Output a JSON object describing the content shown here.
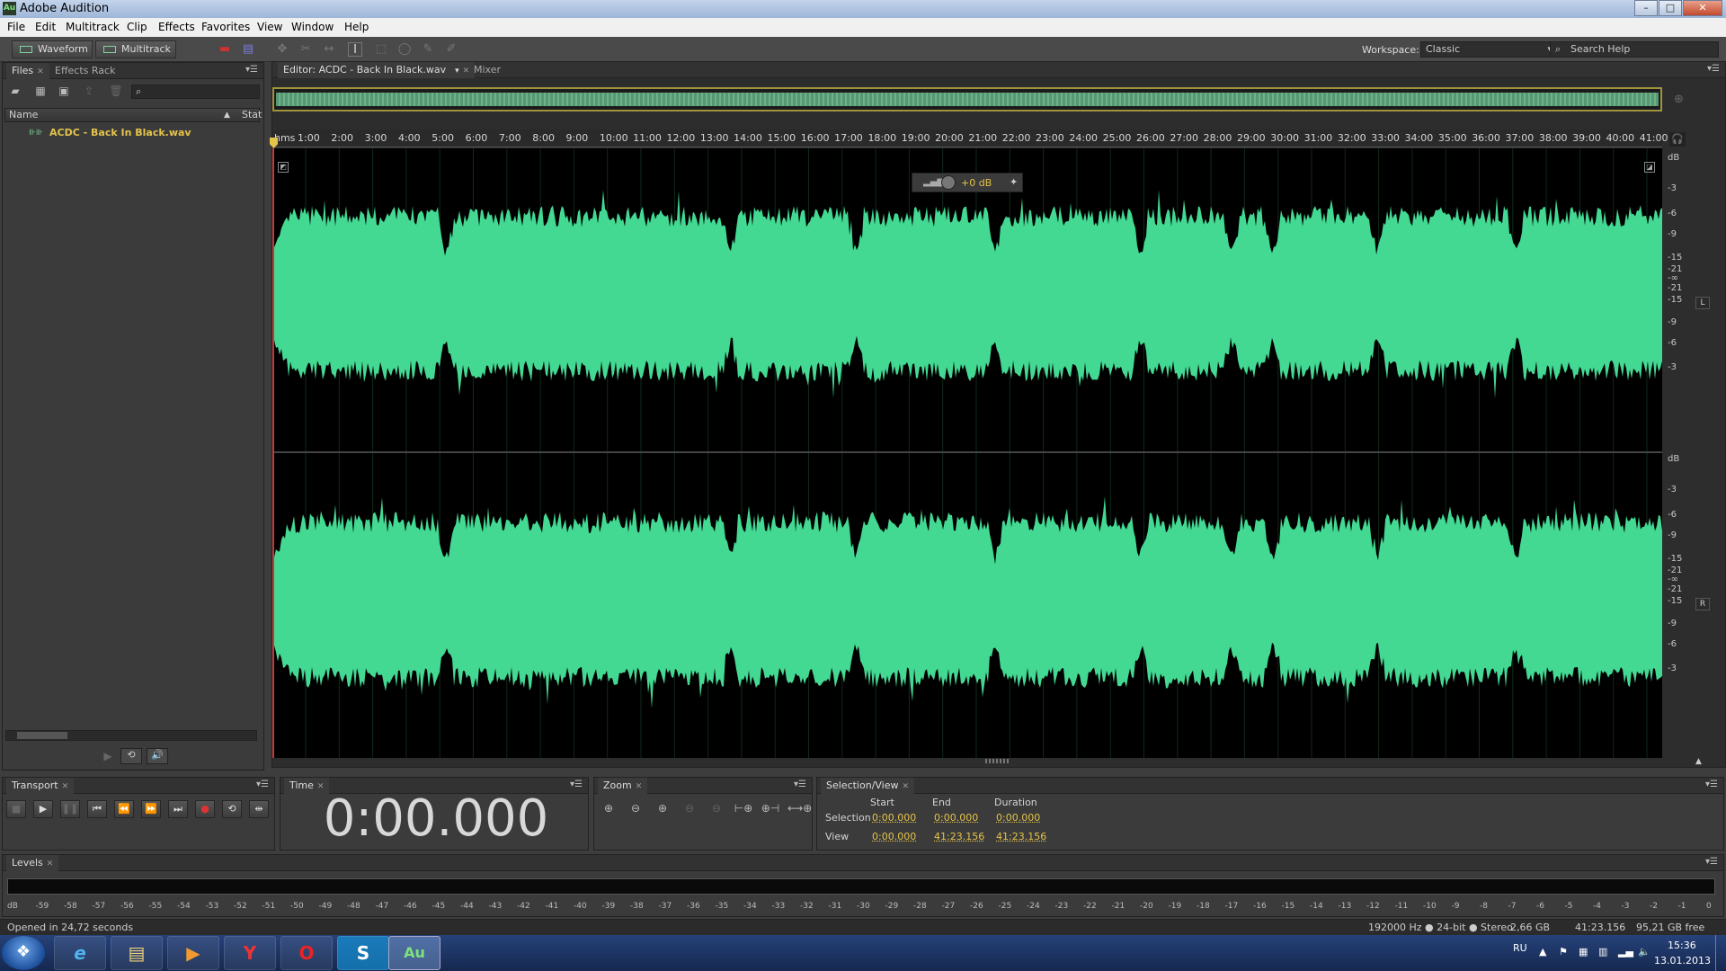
{
  "window": {
    "title": "Adobe Audition",
    "app_icon": "Au",
    "controls": [
      "–",
      "□",
      "✕"
    ]
  },
  "menu": [
    "File",
    "Edit",
    "Multitrack",
    "Clip",
    "Effects",
    "Favorites",
    "View",
    "Window",
    "Help"
  ],
  "toolbar": {
    "waveform_label": "Waveform",
    "multitrack_label": "Multitrack",
    "workspace_label": "Workspace:",
    "workspace_value": "Classic",
    "search_placeholder": "Search Help"
  },
  "files_panel": {
    "tabs": [
      "Files",
      "Effects Rack"
    ],
    "search_value": "",
    "columns": [
      "Name",
      "Stat"
    ],
    "files": [
      {
        "name": "ACDC - Back In Black.wav"
      }
    ]
  },
  "editor": {
    "tabs": [
      "Editor: ACDC - Back In Black.wav",
      "Mixer"
    ],
    "ruler_unit": "hms",
    "ruler_ticks": [
      "1:00",
      "2:00",
      "3:00",
      "4:00",
      "5:00",
      "6:00",
      "7:00",
      "8:00",
      "9:00",
      "10:00",
      "11:00",
      "12:00",
      "13:00",
      "14:00",
      "15:00",
      "16:00",
      "17:00",
      "18:00",
      "19:00",
      "20:00",
      "21:00",
      "22:00",
      "23:00",
      "24:00",
      "25:00",
      "26:00",
      "27:00",
      "28:00",
      "29:00",
      "30:00",
      "31:00",
      "32:00",
      "33:00",
      "34:00",
      "35:00",
      "36:00",
      "37:00",
      "38:00",
      "39:00",
      "40:00",
      "41:00"
    ],
    "hud_gain": "+0 dB",
    "db_scale_label": "dB",
    "db_scale_top": [
      "-3",
      "-6",
      "-9",
      "-15",
      "-21",
      "-∞",
      "-21",
      "-15",
      "-9",
      "-6",
      "-3"
    ],
    "channels": [
      "L",
      "R"
    ],
    "wave_color": "#43d993"
  },
  "transport": {
    "tab": "Transport",
    "buttons": [
      "stop",
      "play",
      "pause",
      "go-to-start",
      "rewind",
      "fast-forward",
      "go-to-end",
      "record",
      "loop",
      "skip-selection"
    ]
  },
  "time": {
    "tab": "Time",
    "value": "0:00.000"
  },
  "zoom": {
    "tab": "Zoom"
  },
  "selection_view": {
    "tab": "Selection/View",
    "headers": [
      "Start",
      "End",
      "Duration"
    ],
    "rows": [
      {
        "label": "Selection",
        "start": "0:00.000",
        "end": "0:00.000",
        "duration": "0:00.000"
      },
      {
        "label": "View",
        "start": "0:00.000",
        "end": "41:23.156",
        "duration": "41:23.156"
      }
    ]
  },
  "levels": {
    "tab": "Levels",
    "ticks": [
      "dB",
      "-59",
      "-58",
      "-57",
      "-56",
      "-55",
      "-54",
      "-53",
      "-52",
      "-51",
      "-50",
      "-49",
      "-48",
      "-47",
      "-46",
      "-45",
      "-44",
      "-43",
      "-42",
      "-41",
      "-40",
      "-39",
      "-38",
      "-37",
      "-36",
      "-35",
      "-34",
      "-33",
      "-32",
      "-31",
      "-30",
      "-29",
      "-28",
      "-27",
      "-26",
      "-25",
      "-24",
      "-23",
      "-22",
      "-21",
      "-20",
      "-19",
      "-18",
      "-17",
      "-16",
      "-15",
      "-14",
      "-13",
      "-12",
      "-11",
      "-10",
      "-9",
      "-8",
      "-7",
      "-6",
      "-5",
      "-4",
      "-3",
      "-2",
      "-1",
      "0"
    ]
  },
  "status": {
    "message": "Opened in 24,72 seconds",
    "format": "192000 Hz ● 24-bit ● Stereo",
    "size": "2,66 GB",
    "duration": "41:23.156",
    "free": "95,21 GB free"
  },
  "taskbar": {
    "apps": [
      "internet-explorer",
      "file-explorer",
      "media-player",
      "yandex-browser",
      "opera",
      "skype",
      "adobe-audition"
    ],
    "app_glyphs": [
      "e",
      "▤",
      "▶",
      "Y",
      "O",
      "S",
      "Au"
    ],
    "lang": "RU",
    "time": "15:36",
    "date": "13.01.2013"
  }
}
